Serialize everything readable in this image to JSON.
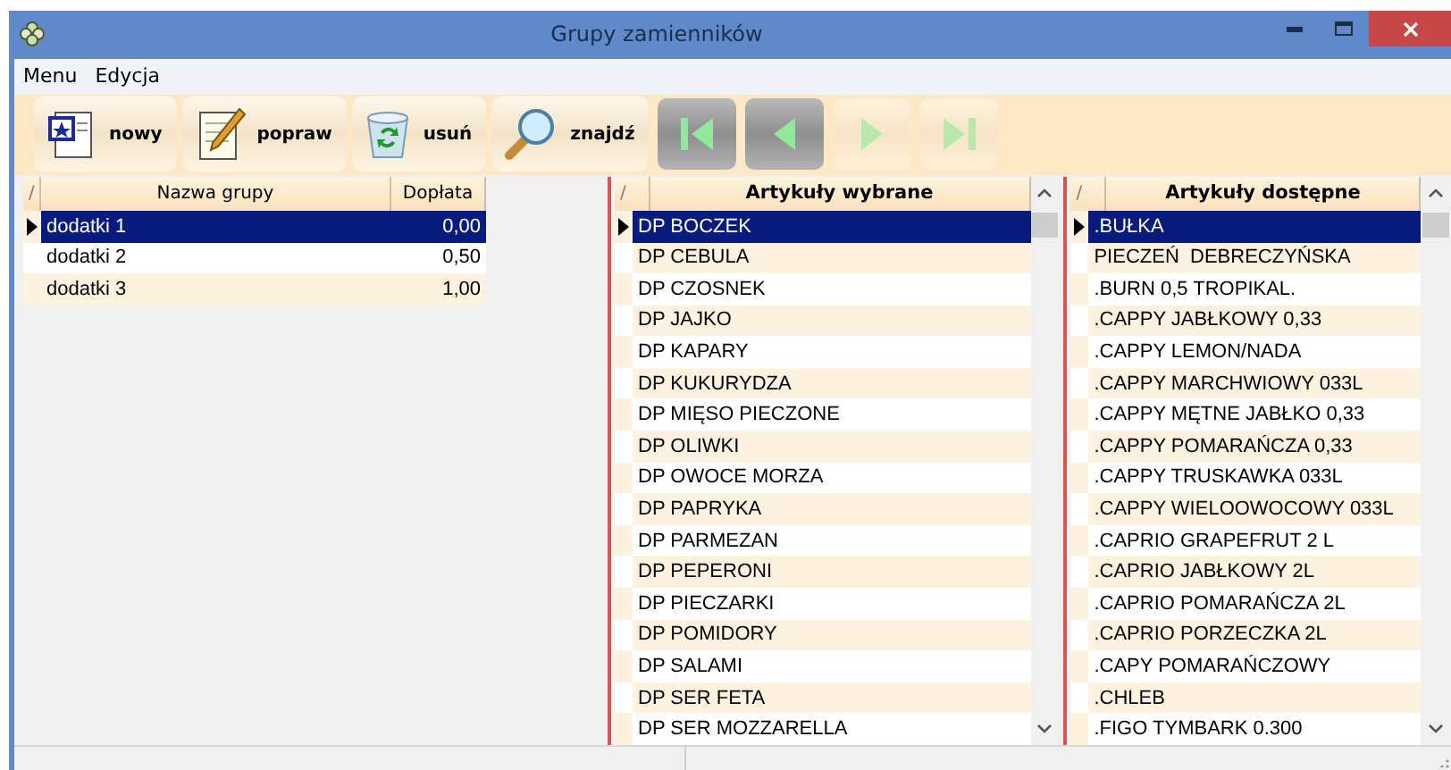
{
  "window": {
    "title": "Grupy zamienników"
  },
  "menu": [
    {
      "label": "Menu"
    },
    {
      "label": "Edycja"
    }
  ],
  "toolbar": [
    {
      "label": "nowy"
    },
    {
      "label": "popraw"
    },
    {
      "label": "usuń"
    },
    {
      "label": "znajdź"
    }
  ],
  "nav_buttons": [
    {
      "disabled": false
    },
    {
      "disabled": false
    },
    {
      "disabled": true
    },
    {
      "disabled": true
    }
  ],
  "groups_table": {
    "columns": [
      "/",
      "Nazwa grupy",
      "Dopłata"
    ],
    "rows": [
      {
        "name": "dodatki 1",
        "surcharge": "0,00",
        "selected": true
      },
      {
        "name": "dodatki 2",
        "surcharge": "0,50",
        "selected": false
      },
      {
        "name": "dodatki 3",
        "surcharge": "1,00",
        "selected": false
      }
    ]
  },
  "selected_articles": {
    "columns": [
      "/",
      "Artykuły wybrane"
    ],
    "rows": [
      {
        "name": "DP BOCZEK",
        "selected": true
      },
      {
        "name": "DP CEBULA",
        "selected": false
      },
      {
        "name": "DP CZOSNEK",
        "selected": false
      },
      {
        "name": "DP JAJKO",
        "selected": false
      },
      {
        "name": "DP KAPARY",
        "selected": false
      },
      {
        "name": "DP KUKURYDZA",
        "selected": false
      },
      {
        "name": "DP MIĘSO PIECZONE",
        "selected": false
      },
      {
        "name": "DP OLIWKI",
        "selected": false
      },
      {
        "name": "DP OWOCE MORZA",
        "selected": false
      },
      {
        "name": "DP PAPRYKA",
        "selected": false
      },
      {
        "name": "DP PARMEZAN",
        "selected": false
      },
      {
        "name": "DP PEPERONI",
        "selected": false
      },
      {
        "name": "DP PIECZARKI",
        "selected": false
      },
      {
        "name": "DP POMIDORY",
        "selected": false
      },
      {
        "name": "DP SALAMI",
        "selected": false
      },
      {
        "name": "DP SER FETA",
        "selected": false
      },
      {
        "name": "DP SER MOZZARELLA",
        "selected": false
      }
    ]
  },
  "available_articles": {
    "columns": [
      "/",
      "Artykuły dostępne"
    ],
    "rows": [
      {
        "name": ".BUŁKA",
        "selected": true
      },
      {
        "name": "PIECZEŃ  DEBRECZYŃSKA",
        "selected": false
      },
      {
        "name": ".BURN 0,5 TROPIKAL.",
        "selected": false
      },
      {
        "name": ".CAPPY JABŁKOWY 0,33",
        "selected": false
      },
      {
        "name": ".CAPPY LEMON/NADA",
        "selected": false
      },
      {
        "name": ".CAPPY MARCHWIOWY 033L",
        "selected": false
      },
      {
        "name": ".CAPPY MĘTNE JABŁKO 0,33",
        "selected": false
      },
      {
        "name": ".CAPPY POMARAŃCZA 0,33",
        "selected": false
      },
      {
        "name": ".CAPPY TRUSKAWKA 033L",
        "selected": false
      },
      {
        "name": ".CAPPY WIELOOWOCOWY 033L",
        "selected": false
      },
      {
        "name": ".CAPRIO GRAPEFRUT 2 L",
        "selected": false
      },
      {
        "name": ".CAPRIO JABŁKOWY 2L",
        "selected": false
      },
      {
        "name": ".CAPRIO POMARAŃCZA 2L",
        "selected": false
      },
      {
        "name": ".CAPRIO PORZECZKA 2L",
        "selected": false
      },
      {
        "name": ".CAPY POMARAŃCZOWY",
        "selected": false
      },
      {
        "name": ".CHLEB",
        "selected": false
      },
      {
        "name": ".FIGO TYMBARK 0.300",
        "selected": false
      }
    ]
  }
}
